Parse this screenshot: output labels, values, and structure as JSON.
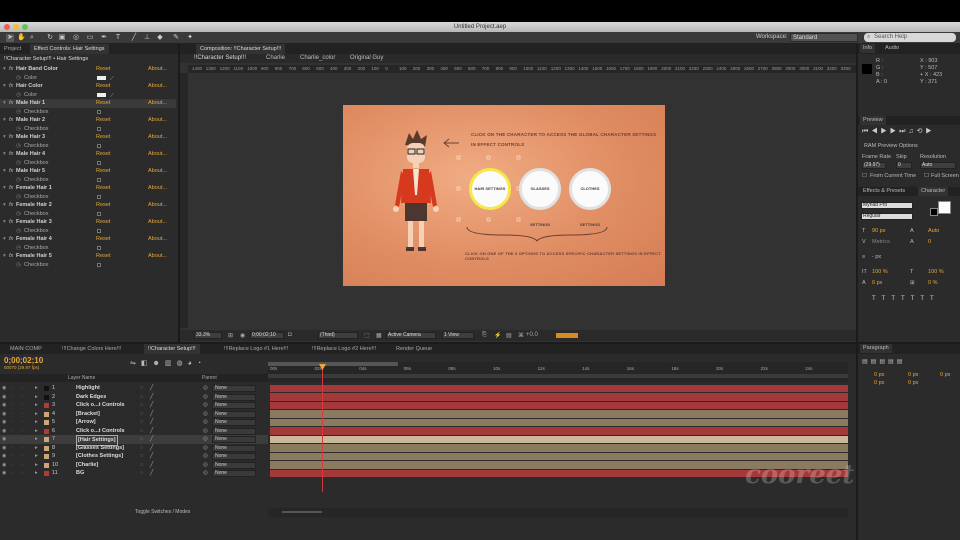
{
  "window": {
    "title": "Untitled Project.aep"
  },
  "toolbar": {
    "tools": [
      "selection-tool",
      "hand-tool",
      "zoom-tool",
      "rotate-tool",
      "camera-tool",
      "pan-behind-tool",
      "mask-tool",
      "pen-tool",
      "type-tool",
      "brush-tool",
      "clone-tool",
      "eraser-tool",
      "roto-brush-tool",
      "puppet-tool"
    ],
    "workspace_label": "Workspace:",
    "workspace_value": "Standard",
    "search_placeholder": "Search Help"
  },
  "left_panel": {
    "tabs": [
      "Project",
      "Effect Controls: Hair Settings"
    ],
    "subheader": "!!Character Setup!!! • Hair Settings",
    "rows": [
      {
        "kind": "effect",
        "label": "Hair Band Color",
        "reset": "Reset",
        "about": "About..."
      },
      {
        "kind": "param",
        "label": "Color",
        "control": "swatch"
      },
      {
        "kind": "effect",
        "label": "Hair Color",
        "reset": "Reset",
        "about": "About..."
      },
      {
        "kind": "param",
        "label": "Color",
        "control": "swatch"
      },
      {
        "kind": "effect",
        "label": "Male Hair 1",
        "reset": "Reset",
        "about": "About...",
        "highlight": true
      },
      {
        "kind": "param",
        "label": "Checkbox",
        "control": "checkbox"
      },
      {
        "kind": "effect",
        "label": "Male Hair 2",
        "reset": "Reset",
        "about": "About..."
      },
      {
        "kind": "param",
        "label": "Checkbox",
        "control": "checkbox"
      },
      {
        "kind": "effect",
        "label": "Male Hair 3",
        "reset": "Reset",
        "about": "About..."
      },
      {
        "kind": "param",
        "label": "Checkbox",
        "control": "checkbox"
      },
      {
        "kind": "effect",
        "label": "Male Hair 4",
        "reset": "Reset",
        "about": "About..."
      },
      {
        "kind": "param",
        "label": "Checkbox",
        "control": "checkbox"
      },
      {
        "kind": "effect",
        "label": "Male Hair 5",
        "reset": "Reset",
        "about": "About..."
      },
      {
        "kind": "param",
        "label": "Checkbox",
        "control": "checkbox"
      },
      {
        "kind": "effect",
        "label": "Female Hair 1",
        "reset": "Reset",
        "about": "About..."
      },
      {
        "kind": "param",
        "label": "Checkbox",
        "control": "checkbox"
      },
      {
        "kind": "effect",
        "label": "Female Hair 2",
        "reset": "Reset",
        "about": "About..."
      },
      {
        "kind": "param",
        "label": "Checkbox",
        "control": "checkbox"
      },
      {
        "kind": "effect",
        "label": "Female Hair 3",
        "reset": "Reset",
        "about": "About..."
      },
      {
        "kind": "param",
        "label": "Checkbox",
        "control": "checkbox"
      },
      {
        "kind": "effect",
        "label": "Female Hair 4",
        "reset": "Reset",
        "about": "About..."
      },
      {
        "kind": "param",
        "label": "Checkbox",
        "control": "checkbox"
      },
      {
        "kind": "effect",
        "label": "Female Hair 5",
        "reset": "Reset",
        "about": "About..."
      },
      {
        "kind": "param",
        "label": "Checkbox",
        "control": "checkbox"
      }
    ]
  },
  "composition": {
    "tab": "Composition: !!Character Setup!!!",
    "breadcrumbs": [
      "!!Character Setup!!!",
      "Charlie",
      "Charlie_color",
      "Original Guy"
    ],
    "ruler_ticks": [
      "1400",
      "1300",
      "1200",
      "1100",
      "1000",
      "900",
      "800",
      "700",
      "600",
      "500",
      "400",
      "300",
      "200",
      "100",
      "0",
      "100",
      "200",
      "300",
      "400",
      "500",
      "600",
      "700",
      "800",
      "900",
      "1000",
      "1100",
      "1200",
      "1300",
      "1400",
      "1500",
      "1600",
      "1700",
      "1800",
      "1900",
      "2000",
      "2100",
      "2200",
      "2300",
      "2400",
      "2500",
      "2600",
      "2700",
      "2800",
      "2900",
      "3000",
      "3100",
      "3200",
      "3300"
    ],
    "frame_text": {
      "instruction_top_line1": "CLICK ON THE CHARACTER TO ACCESS THE GLOBAL CHARACTER SETTINGS",
      "instruction_top_line2": "IN EFFECT CONTROLS",
      "btn_hair": "HAIR SETTINGS",
      "btn_glasses": "GLASSES SETTINGS",
      "btn_clothes": "CLOTHES SETTINGS",
      "instruction_bottom": "CLICK ON ONE OF THE 3 OPTIONS TO ACCESS SPECIFIC CHARACTER SETTINGS IN EFFECT CONTROLS"
    },
    "footer": {
      "zoom": "33.3%",
      "timecode": "0;00;02;10",
      "resolution": "(Third)",
      "camera": "Active Camera",
      "view": "1 View",
      "exposure": "+0.0"
    }
  },
  "right_panel": {
    "tabs_top": [
      "Info",
      "Audio"
    ],
    "info": {
      "R": "R :",
      "G": "G :",
      "B": "B :",
      "A": "A : 0",
      "X": "X : 903",
      "Y": "Y : 507",
      "X2": "+ X : 423",
      "Y2": "Y : 371"
    },
    "preview_tab": "Preview",
    "ram_preview": "RAM Preview Options",
    "frame_rate_label": "Frame Rate",
    "skip_label": "Skip",
    "resolution_label": "Resolution",
    "frame_rate_value": "(29.97)",
    "skip_value": "0",
    "resolution_value": "Auto",
    "from_current": "From Current Time",
    "full_screen": "Full Screen",
    "tabs_mid": [
      "Effects & Presets",
      "Character"
    ],
    "font_name": "Myriad Pro",
    "font_style": "Regular",
    "font_size": "90 px",
    "leading": "Auto",
    "kerning": "Metrics",
    "tracking": "0",
    "stroke": "- px",
    "vscale": "100 %",
    "hscale": "100 %",
    "baseline": "0 px",
    "tsume": "0 %",
    "paragraph_tab": "Paragraph",
    "para_fields": [
      "0 px",
      "0 px",
      "0 px",
      "0 px",
      "0 px"
    ]
  },
  "timeline": {
    "tabs": [
      "MAIN COMP",
      "!!!Change Colors Here!!!",
      "!!Character Setup!!!",
      "!!!Replace Logo #1 Here!!!",
      "!!!Replace Logo #2 Here!!!",
      "Render Queue"
    ],
    "timecode": "0;00;02;10",
    "fps": "00070 (29.97 fps)",
    "col_layer_name": "Layer Name",
    "col_parent": "Parent",
    "time_ticks": [
      "00s",
      "02s",
      "04s",
      "06s",
      "08s",
      "10s",
      "12s",
      "14s",
      "16s",
      "18s",
      "20s",
      "22s",
      "24s"
    ],
    "layers": [
      {
        "num": "1",
        "name": "Highlight",
        "label_color": "#111111",
        "bar": "#a3393b"
      },
      {
        "num": "2",
        "name": "Dark Edges",
        "label_color": "#111111",
        "bar": "#a3393b"
      },
      {
        "num": "3",
        "name": "Click o...t Controls",
        "label_color": "#b23a3a",
        "bar": "#a3393b"
      },
      {
        "num": "4",
        "name": "[Bracket]",
        "label_color": "#c8a878",
        "bar": "#8a7a60"
      },
      {
        "num": "5",
        "name": "[Arrow]",
        "label_color": "#c8a878",
        "bar": "#8a7a60"
      },
      {
        "num": "6",
        "name": "Click o...t Controls",
        "label_color": "#b23a3a",
        "bar": "#a3393b"
      },
      {
        "num": "7",
        "name": "[Hair Settings]",
        "label_color": "#c8a878",
        "bar": "#c9b99a"
      },
      {
        "num": "8",
        "name": "[Glasses Settings]",
        "label_color": "#c8a878",
        "bar": "#8a7a60"
      },
      {
        "num": "9",
        "name": "[Clothes Settings]",
        "label_color": "#c8a878",
        "bar": "#8a7a60"
      },
      {
        "num": "10",
        "name": "[Charlie]",
        "label_color": "#c8a878",
        "bar": "#8a7a60"
      },
      {
        "num": "11",
        "name": "BG",
        "label_color": "#b23a3a",
        "bar": "#a3393b"
      }
    ],
    "parent_value": "None",
    "toggle_label": "Toggle Switches / Modes"
  },
  "watermark": "cooreet",
  "colors": {
    "accent": "#e8a83b",
    "playhead": "#d33a3a"
  }
}
